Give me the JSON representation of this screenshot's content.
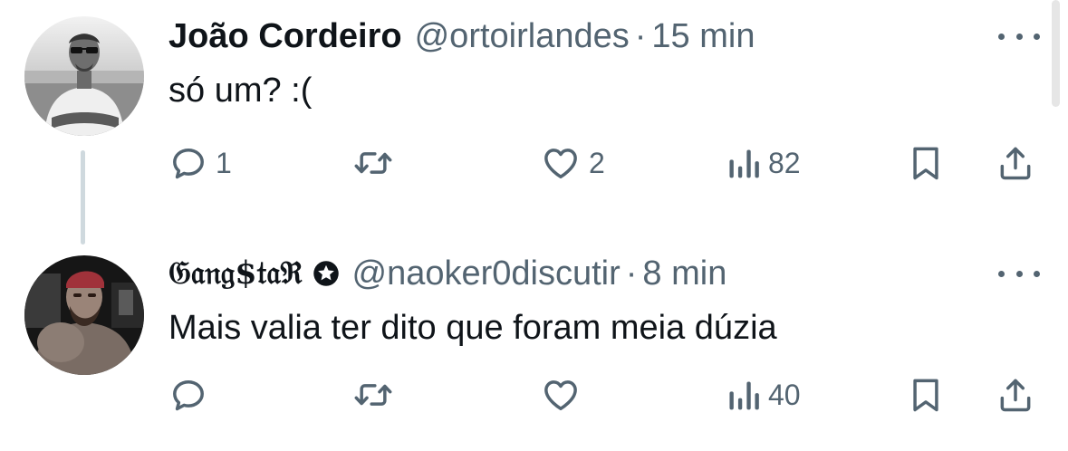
{
  "tweets": [
    {
      "author_name": "João Cordeiro",
      "handle": "@ortoirlandes",
      "separator": "·",
      "time": "15 min",
      "text": "só um? :(",
      "reply_count": "1",
      "retweet_count": "",
      "like_count": "2",
      "view_count": "82"
    },
    {
      "author_name": "𝔊𝔞𝔫𝔤$𝔱𝔞ℜ",
      "handle": "@naoker0discutir",
      "separator": "·",
      "time": "8 min",
      "text": "Mais valia ter dito que foram meia dúzia",
      "reply_count": "",
      "retweet_count": "",
      "like_count": "",
      "view_count": "40"
    }
  ],
  "icons": {
    "reply": "reply-icon",
    "retweet": "retweet-icon",
    "like": "heart-icon",
    "views": "views-icon",
    "bookmark": "bookmark-icon",
    "share": "share-icon",
    "more": "more-icon",
    "badge": "star-badge-icon"
  },
  "colors": {
    "text": "#0f1419",
    "secondary": "#536471",
    "thread_line": "#cfd9de"
  }
}
